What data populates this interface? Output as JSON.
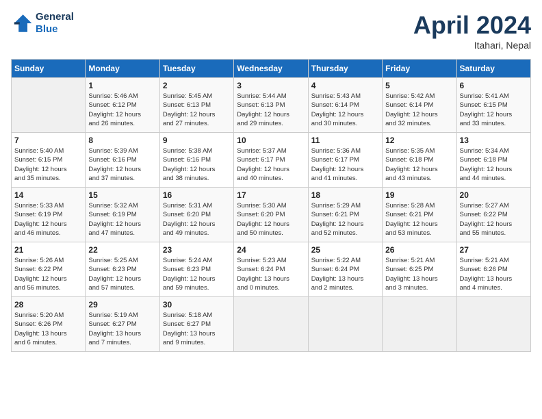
{
  "header": {
    "logo_line1": "General",
    "logo_line2": "Blue",
    "month": "April 2024",
    "location": "Itahari, Nepal"
  },
  "days_of_week": [
    "Sunday",
    "Monday",
    "Tuesday",
    "Wednesday",
    "Thursday",
    "Friday",
    "Saturday"
  ],
  "weeks": [
    [
      {
        "day": "",
        "info": ""
      },
      {
        "day": "1",
        "info": "Sunrise: 5:46 AM\nSunset: 6:12 PM\nDaylight: 12 hours\nand 26 minutes."
      },
      {
        "day": "2",
        "info": "Sunrise: 5:45 AM\nSunset: 6:13 PM\nDaylight: 12 hours\nand 27 minutes."
      },
      {
        "day": "3",
        "info": "Sunrise: 5:44 AM\nSunset: 6:13 PM\nDaylight: 12 hours\nand 29 minutes."
      },
      {
        "day": "4",
        "info": "Sunrise: 5:43 AM\nSunset: 6:14 PM\nDaylight: 12 hours\nand 30 minutes."
      },
      {
        "day": "5",
        "info": "Sunrise: 5:42 AM\nSunset: 6:14 PM\nDaylight: 12 hours\nand 32 minutes."
      },
      {
        "day": "6",
        "info": "Sunrise: 5:41 AM\nSunset: 6:15 PM\nDaylight: 12 hours\nand 33 minutes."
      }
    ],
    [
      {
        "day": "7",
        "info": "Sunrise: 5:40 AM\nSunset: 6:15 PM\nDaylight: 12 hours\nand 35 minutes."
      },
      {
        "day": "8",
        "info": "Sunrise: 5:39 AM\nSunset: 6:16 PM\nDaylight: 12 hours\nand 37 minutes."
      },
      {
        "day": "9",
        "info": "Sunrise: 5:38 AM\nSunset: 6:16 PM\nDaylight: 12 hours\nand 38 minutes."
      },
      {
        "day": "10",
        "info": "Sunrise: 5:37 AM\nSunset: 6:17 PM\nDaylight: 12 hours\nand 40 minutes."
      },
      {
        "day": "11",
        "info": "Sunrise: 5:36 AM\nSunset: 6:17 PM\nDaylight: 12 hours\nand 41 minutes."
      },
      {
        "day": "12",
        "info": "Sunrise: 5:35 AM\nSunset: 6:18 PM\nDaylight: 12 hours\nand 43 minutes."
      },
      {
        "day": "13",
        "info": "Sunrise: 5:34 AM\nSunset: 6:18 PM\nDaylight: 12 hours\nand 44 minutes."
      }
    ],
    [
      {
        "day": "14",
        "info": "Sunrise: 5:33 AM\nSunset: 6:19 PM\nDaylight: 12 hours\nand 46 minutes."
      },
      {
        "day": "15",
        "info": "Sunrise: 5:32 AM\nSunset: 6:19 PM\nDaylight: 12 hours\nand 47 minutes."
      },
      {
        "day": "16",
        "info": "Sunrise: 5:31 AM\nSunset: 6:20 PM\nDaylight: 12 hours\nand 49 minutes."
      },
      {
        "day": "17",
        "info": "Sunrise: 5:30 AM\nSunset: 6:20 PM\nDaylight: 12 hours\nand 50 minutes."
      },
      {
        "day": "18",
        "info": "Sunrise: 5:29 AM\nSunset: 6:21 PM\nDaylight: 12 hours\nand 52 minutes."
      },
      {
        "day": "19",
        "info": "Sunrise: 5:28 AM\nSunset: 6:21 PM\nDaylight: 12 hours\nand 53 minutes."
      },
      {
        "day": "20",
        "info": "Sunrise: 5:27 AM\nSunset: 6:22 PM\nDaylight: 12 hours\nand 55 minutes."
      }
    ],
    [
      {
        "day": "21",
        "info": "Sunrise: 5:26 AM\nSunset: 6:22 PM\nDaylight: 12 hours\nand 56 minutes."
      },
      {
        "day": "22",
        "info": "Sunrise: 5:25 AM\nSunset: 6:23 PM\nDaylight: 12 hours\nand 57 minutes."
      },
      {
        "day": "23",
        "info": "Sunrise: 5:24 AM\nSunset: 6:23 PM\nDaylight: 12 hours\nand 59 minutes."
      },
      {
        "day": "24",
        "info": "Sunrise: 5:23 AM\nSunset: 6:24 PM\nDaylight: 13 hours\nand 0 minutes."
      },
      {
        "day": "25",
        "info": "Sunrise: 5:22 AM\nSunset: 6:24 PM\nDaylight: 13 hours\nand 2 minutes."
      },
      {
        "day": "26",
        "info": "Sunrise: 5:21 AM\nSunset: 6:25 PM\nDaylight: 13 hours\nand 3 minutes."
      },
      {
        "day": "27",
        "info": "Sunrise: 5:21 AM\nSunset: 6:26 PM\nDaylight: 13 hours\nand 4 minutes."
      }
    ],
    [
      {
        "day": "28",
        "info": "Sunrise: 5:20 AM\nSunset: 6:26 PM\nDaylight: 13 hours\nand 6 minutes."
      },
      {
        "day": "29",
        "info": "Sunrise: 5:19 AM\nSunset: 6:27 PM\nDaylight: 13 hours\nand 7 minutes."
      },
      {
        "day": "30",
        "info": "Sunrise: 5:18 AM\nSunset: 6:27 PM\nDaylight: 13 hours\nand 9 minutes."
      },
      {
        "day": "",
        "info": ""
      },
      {
        "day": "",
        "info": ""
      },
      {
        "day": "",
        "info": ""
      },
      {
        "day": "",
        "info": ""
      }
    ]
  ]
}
